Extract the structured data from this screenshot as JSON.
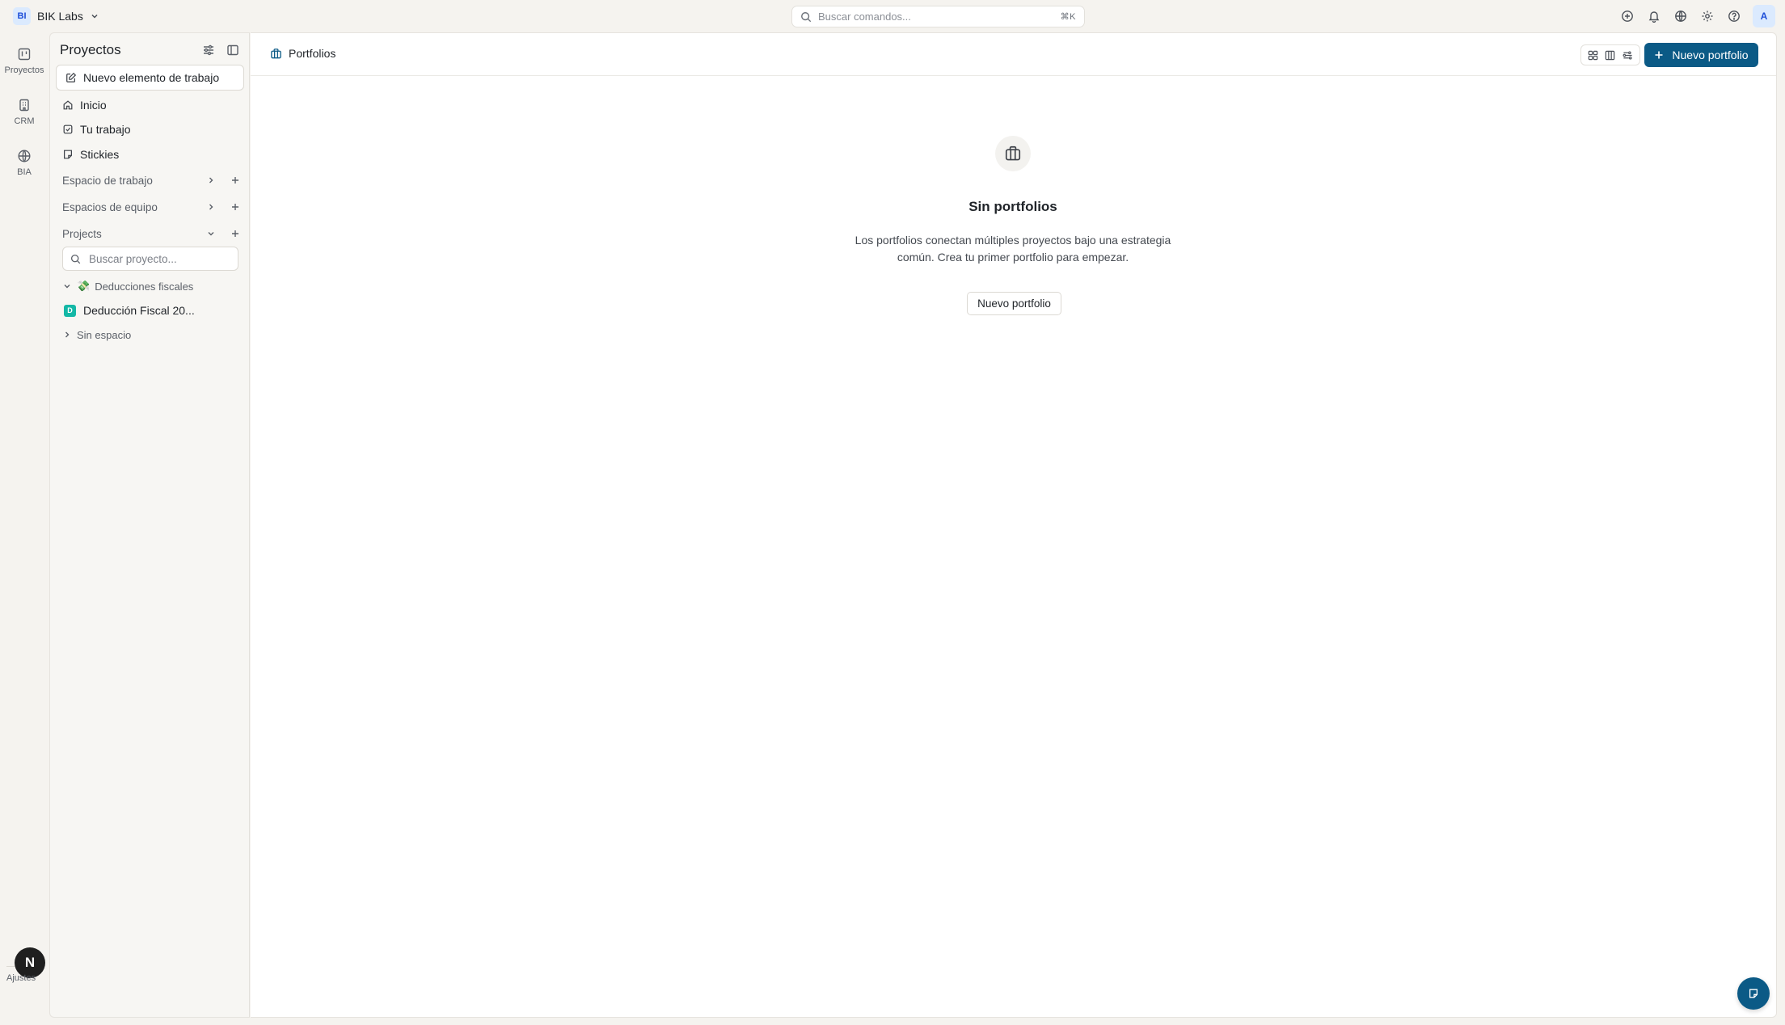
{
  "workspace": {
    "initials": "BI",
    "name": "BIK Labs"
  },
  "command_search": {
    "placeholder": "Buscar comandos...",
    "shortcut": "⌘K"
  },
  "user": {
    "initial": "A"
  },
  "rail": {
    "items": [
      {
        "label": "Proyectos",
        "icon": "kanban-icon"
      },
      {
        "label": "CRM",
        "icon": "building-icon"
      },
      {
        "label": "BIA",
        "icon": "globe-icon"
      }
    ],
    "settings_initial": "N",
    "settings_label": "Ajustes"
  },
  "sidebar": {
    "title": "Proyectos",
    "new_item_label": "Nuevo elemento de trabajo",
    "nav": [
      {
        "label": "Inicio",
        "icon": "home-icon"
      },
      {
        "label": "Tu trabajo",
        "icon": "check-square-icon"
      },
      {
        "label": "Stickies",
        "icon": "sticky-note-icon"
      }
    ],
    "sections": [
      {
        "label": "Espacio de trabajo",
        "state": "collapsed"
      },
      {
        "label": "Espacios de equipo",
        "state": "collapsed"
      },
      {
        "label": "Projects",
        "state": "expanded"
      }
    ],
    "project_search_placeholder": "Buscar proyecto...",
    "tree": {
      "group_label": "Deducciones fiscales",
      "group_emoji": "💸",
      "project": {
        "badge": "D",
        "name": "Deducción Fiscal 20..."
      },
      "ungrouped_label": "Sin espacio"
    }
  },
  "main": {
    "breadcrumb": "Portfolios",
    "new_portfolio_label": "Nuevo portfolio",
    "empty_state": {
      "title": "Sin portfolios",
      "description": "Los portfolios conectan múltiples proyectos bajo una estrategia común. Crea tu primer portfolio para empezar.",
      "button_label": "Nuevo portfolio"
    }
  },
  "colors": {
    "primary": "#0b5a86",
    "project_badge": "#14b8a6",
    "background": "#f5f3ef"
  }
}
